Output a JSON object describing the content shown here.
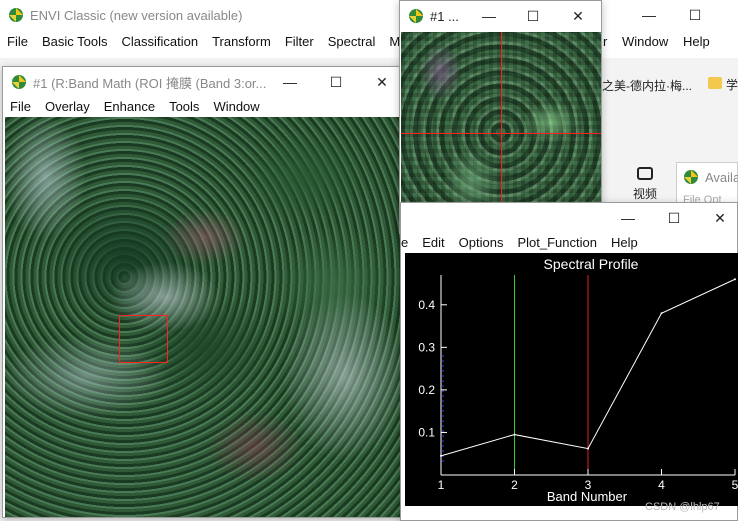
{
  "main_window": {
    "title": "ENVI Classic (new version available)",
    "menu": [
      "File",
      "Basic Tools",
      "Classification",
      "Transform",
      "Filter",
      "Spectral",
      "M"
    ],
    "menu_right": [
      "Window",
      "Help"
    ],
    "menu_partial": "r"
  },
  "browser_bg": {
    "tab_text": "之美-德内拉·梅...",
    "tab_text2": "学",
    "video_label": "视频",
    "avail_label": "Availa",
    "avail_sub": "File  Opt"
  },
  "image_window": {
    "title": "#1 (R:Band Math (ROI 掩膜 (Band 3:or...",
    "menu": [
      "File",
      "Overlay",
      "Enhance",
      "Tools",
      "Window"
    ]
  },
  "zoom_window": {
    "title": "#1 ..."
  },
  "spectral_window": {
    "menu_partial": "e",
    "menu": [
      "Edit",
      "Options",
      "Plot_Function",
      "Help"
    ]
  },
  "chart_data": {
    "type": "line",
    "title": "Spectral Profile",
    "xlabel": "Band Number",
    "ylabel": "",
    "x": [
      1,
      2,
      3,
      4,
      5
    ],
    "values": [
      0.045,
      0.095,
      0.062,
      0.38,
      0.46
    ],
    "xlim": [
      1,
      5
    ],
    "ylim": [
      0.0,
      0.47
    ],
    "x_ticks": [
      "1",
      "2",
      "3",
      "4",
      "5"
    ],
    "y_ticks": [
      "0.1",
      "0.2",
      "0.3",
      "0.4"
    ],
    "y_tick_values": [
      0.1,
      0.2,
      0.3,
      0.4
    ],
    "markers": [
      {
        "x": 2,
        "color": "#33cc33"
      },
      {
        "x": 3,
        "color": "#dd2222"
      }
    ],
    "background": "#000000",
    "line_color": "#ffffff"
  },
  "watermark": "CSDN @lhlp67"
}
